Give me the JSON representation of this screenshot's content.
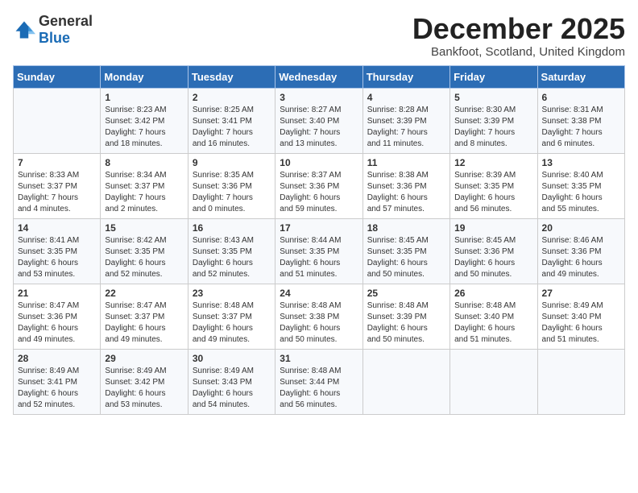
{
  "logo": {
    "general": "General",
    "blue": "Blue"
  },
  "header": {
    "month": "December 2025",
    "location": "Bankfoot, Scotland, United Kingdom"
  },
  "days_of_week": [
    "Sunday",
    "Monday",
    "Tuesday",
    "Wednesday",
    "Thursday",
    "Friday",
    "Saturday"
  ],
  "weeks": [
    [
      {
        "day": "",
        "content": ""
      },
      {
        "day": "1",
        "content": "Sunrise: 8:23 AM\nSunset: 3:42 PM\nDaylight: 7 hours\nand 18 minutes."
      },
      {
        "day": "2",
        "content": "Sunrise: 8:25 AM\nSunset: 3:41 PM\nDaylight: 7 hours\nand 16 minutes."
      },
      {
        "day": "3",
        "content": "Sunrise: 8:27 AM\nSunset: 3:40 PM\nDaylight: 7 hours\nand 13 minutes."
      },
      {
        "day": "4",
        "content": "Sunrise: 8:28 AM\nSunset: 3:39 PM\nDaylight: 7 hours\nand 11 minutes."
      },
      {
        "day": "5",
        "content": "Sunrise: 8:30 AM\nSunset: 3:39 PM\nDaylight: 7 hours\nand 8 minutes."
      },
      {
        "day": "6",
        "content": "Sunrise: 8:31 AM\nSunset: 3:38 PM\nDaylight: 7 hours\nand 6 minutes."
      }
    ],
    [
      {
        "day": "7",
        "content": "Sunrise: 8:33 AM\nSunset: 3:37 PM\nDaylight: 7 hours\nand 4 minutes."
      },
      {
        "day": "8",
        "content": "Sunrise: 8:34 AM\nSunset: 3:37 PM\nDaylight: 7 hours\nand 2 minutes."
      },
      {
        "day": "9",
        "content": "Sunrise: 8:35 AM\nSunset: 3:36 PM\nDaylight: 7 hours\nand 0 minutes."
      },
      {
        "day": "10",
        "content": "Sunrise: 8:37 AM\nSunset: 3:36 PM\nDaylight: 6 hours\nand 59 minutes."
      },
      {
        "day": "11",
        "content": "Sunrise: 8:38 AM\nSunset: 3:36 PM\nDaylight: 6 hours\nand 57 minutes."
      },
      {
        "day": "12",
        "content": "Sunrise: 8:39 AM\nSunset: 3:35 PM\nDaylight: 6 hours\nand 56 minutes."
      },
      {
        "day": "13",
        "content": "Sunrise: 8:40 AM\nSunset: 3:35 PM\nDaylight: 6 hours\nand 55 minutes."
      }
    ],
    [
      {
        "day": "14",
        "content": "Sunrise: 8:41 AM\nSunset: 3:35 PM\nDaylight: 6 hours\nand 53 minutes."
      },
      {
        "day": "15",
        "content": "Sunrise: 8:42 AM\nSunset: 3:35 PM\nDaylight: 6 hours\nand 52 minutes."
      },
      {
        "day": "16",
        "content": "Sunrise: 8:43 AM\nSunset: 3:35 PM\nDaylight: 6 hours\nand 52 minutes."
      },
      {
        "day": "17",
        "content": "Sunrise: 8:44 AM\nSunset: 3:35 PM\nDaylight: 6 hours\nand 51 minutes."
      },
      {
        "day": "18",
        "content": "Sunrise: 8:45 AM\nSunset: 3:35 PM\nDaylight: 6 hours\nand 50 minutes."
      },
      {
        "day": "19",
        "content": "Sunrise: 8:45 AM\nSunset: 3:36 PM\nDaylight: 6 hours\nand 50 minutes."
      },
      {
        "day": "20",
        "content": "Sunrise: 8:46 AM\nSunset: 3:36 PM\nDaylight: 6 hours\nand 49 minutes."
      }
    ],
    [
      {
        "day": "21",
        "content": "Sunrise: 8:47 AM\nSunset: 3:36 PM\nDaylight: 6 hours\nand 49 minutes."
      },
      {
        "day": "22",
        "content": "Sunrise: 8:47 AM\nSunset: 3:37 PM\nDaylight: 6 hours\nand 49 minutes."
      },
      {
        "day": "23",
        "content": "Sunrise: 8:48 AM\nSunset: 3:37 PM\nDaylight: 6 hours\nand 49 minutes."
      },
      {
        "day": "24",
        "content": "Sunrise: 8:48 AM\nSunset: 3:38 PM\nDaylight: 6 hours\nand 50 minutes."
      },
      {
        "day": "25",
        "content": "Sunrise: 8:48 AM\nSunset: 3:39 PM\nDaylight: 6 hours\nand 50 minutes."
      },
      {
        "day": "26",
        "content": "Sunrise: 8:48 AM\nSunset: 3:40 PM\nDaylight: 6 hours\nand 51 minutes."
      },
      {
        "day": "27",
        "content": "Sunrise: 8:49 AM\nSunset: 3:40 PM\nDaylight: 6 hours\nand 51 minutes."
      }
    ],
    [
      {
        "day": "28",
        "content": "Sunrise: 8:49 AM\nSunset: 3:41 PM\nDaylight: 6 hours\nand 52 minutes."
      },
      {
        "day": "29",
        "content": "Sunrise: 8:49 AM\nSunset: 3:42 PM\nDaylight: 6 hours\nand 53 minutes."
      },
      {
        "day": "30",
        "content": "Sunrise: 8:49 AM\nSunset: 3:43 PM\nDaylight: 6 hours\nand 54 minutes."
      },
      {
        "day": "31",
        "content": "Sunrise: 8:48 AM\nSunset: 3:44 PM\nDaylight: 6 hours\nand 56 minutes."
      },
      {
        "day": "",
        "content": ""
      },
      {
        "day": "",
        "content": ""
      },
      {
        "day": "",
        "content": ""
      }
    ]
  ]
}
